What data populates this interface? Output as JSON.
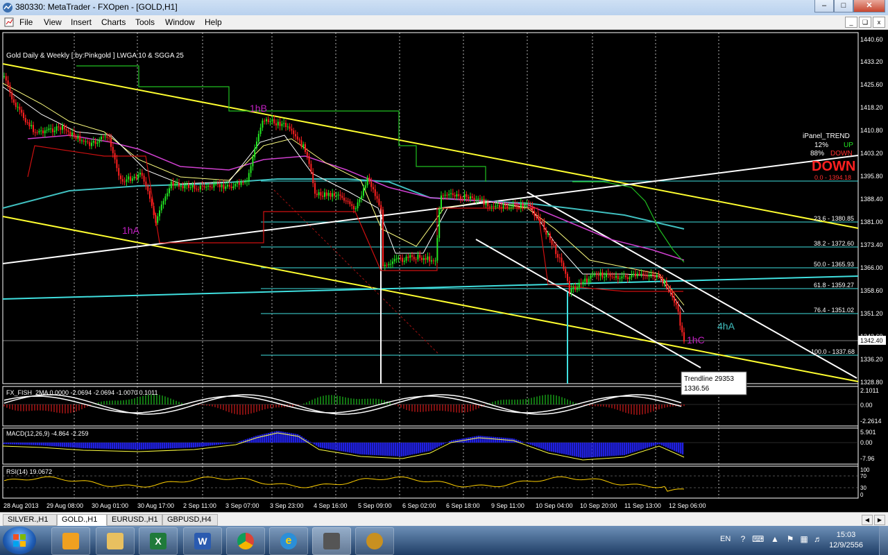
{
  "window": {
    "title": "380330: MetaTrader - FXOpen - [GOLD,H1]"
  },
  "menu": [
    "File",
    "View",
    "Insert",
    "Charts",
    "Tools",
    "Window",
    "Help"
  ],
  "chart": {
    "header": "Gold Daily & Weekly [ by:Pinkgold ] LWGA 10 & SGGA 25",
    "price_axis": [
      "1440.60",
      "1433.20",
      "1425.60",
      "1418.20",
      "1410.80",
      "1403.20",
      "1395.80",
      "1388.40",
      "1381.00",
      "1373.40",
      "1366.00",
      "1358.60",
      "1351.20",
      "1343.60",
      "1336.20",
      "1328.80"
    ],
    "current_price": "1342.40",
    "time_axis": [
      "28 Aug 2013",
      "29 Aug 08:00",
      "30 Aug 01:00",
      "30 Aug 17:00",
      "2 Sep 11:00",
      "3 Sep 07:00",
      "3 Sep 23:00",
      "4 Sep 16:00",
      "5 Sep 09:00",
      "6 Sep 02:00",
      "6 Sep 18:00",
      "9 Sep 11:00",
      "10 Sep 04:00",
      "10 Sep 20:00",
      "11 Sep 13:00",
      "12 Sep 06:00"
    ],
    "wave_labels": {
      "hB": "1hB",
      "hA": "1hA",
      "hC": "1hC",
      "h4A": "4hA"
    },
    "fib": [
      {
        "label": "0.0 - 1394.18",
        "color": "#ff3030"
      },
      {
        "label": "23.6 - 1380.85",
        "color": "#40e0e0"
      },
      {
        "label": "38.2 - 1372.60",
        "color": "#40e0e0"
      },
      {
        "label": "50.0 - 1365.93",
        "color": "#40e0e0"
      },
      {
        "label": "61.8 - 1359.27",
        "color": "#40e0e0"
      },
      {
        "label": "76.4 - 1351.02",
        "color": "#40e0e0"
      },
      {
        "label": "100.0 - 1337.68",
        "color": "#40e0e0"
      }
    ],
    "ipanel": {
      "title": "iPanel_TREND",
      "up_pct": "12%",
      "up_label": "UP",
      "down_pct": "88%",
      "down_label": "DOWN",
      "big": "DOWN"
    },
    "tooltip": {
      "line1": "Trendline 29353",
      "line2": "1336.56"
    },
    "fisher": {
      "label": "FX_FISH_2MA 0.0000 -2.0694 -2.0694 -1.0070 0.1011",
      "axis": [
        "2.1011",
        "0.00",
        "-2.2614"
      ]
    },
    "macd": {
      "label": "MACD(12,26,9) -4.864 -2.259",
      "axis": [
        "5.901",
        "0.00",
        "-7.96"
      ]
    },
    "rsi": {
      "label": "RSI(14) 19.0672",
      "axis": [
        "100",
        "70",
        "30",
        "0"
      ]
    }
  },
  "tabs": [
    {
      "label": "SILVER.,H1",
      "active": false
    },
    {
      "label": "GOLD.,H1",
      "active": true
    },
    {
      "label": "EURUSD.,H1",
      "active": false
    },
    {
      "label": "GBPUSD,H4",
      "active": false
    }
  ],
  "taskbar": {
    "lang": "EN",
    "time": "15:03",
    "date": "12/9/2556",
    "apps": [
      "media-player",
      "file-explorer",
      "excel",
      "word",
      "chrome",
      "internet-explorer",
      "metatrader",
      "gold-app"
    ]
  },
  "colors": {
    "bull": "#22e822",
    "bear": "#ff2020",
    "yellow": "#ffff30",
    "cyan": "#40e0e0",
    "magenta": "#e040e0",
    "label": "#c020c0"
  }
}
